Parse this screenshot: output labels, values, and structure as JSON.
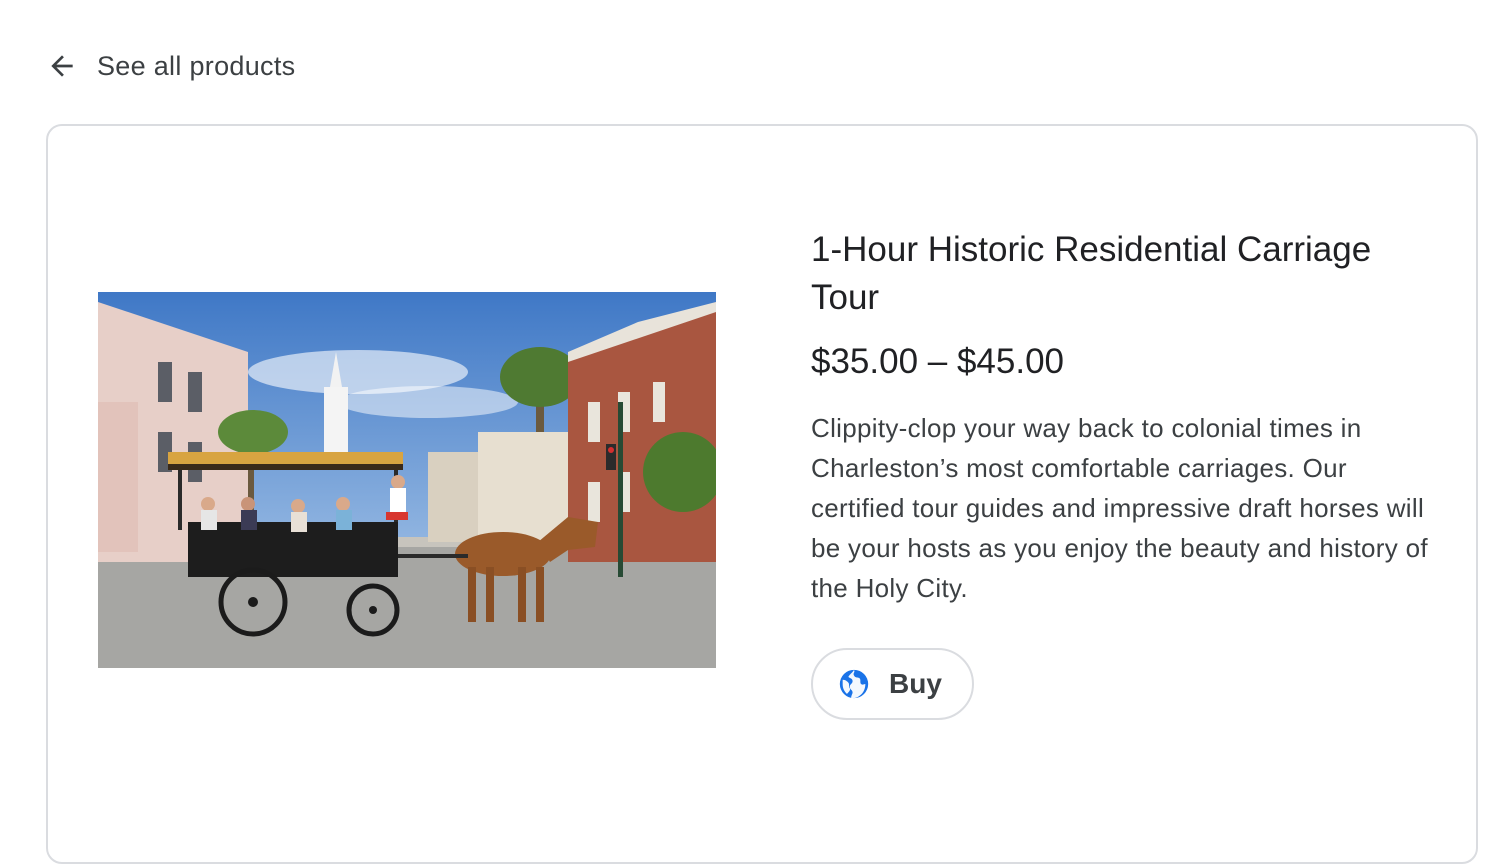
{
  "nav": {
    "back_label": "See all products",
    "back_icon": "arrow-left-icon"
  },
  "product": {
    "title": "1-Hour Historic Residential Carriage Tour",
    "price": "$35.00 – $45.00",
    "description": "Clippity-clop your way back to colonial times in Charleston’s most comfortable carriages. Our certified tour guides and impressive draft horses will be your hosts as you enjoy the beauty and history of the Holy City.",
    "image_alt": "Horse-drawn carriage tour in Charleston street",
    "buy_label": "Buy",
    "buy_icon": "globe-icon"
  },
  "colors": {
    "accent": "#1a73e8",
    "border": "#dadce0",
    "text": "#202124",
    "secondary_text": "#3c4043"
  }
}
